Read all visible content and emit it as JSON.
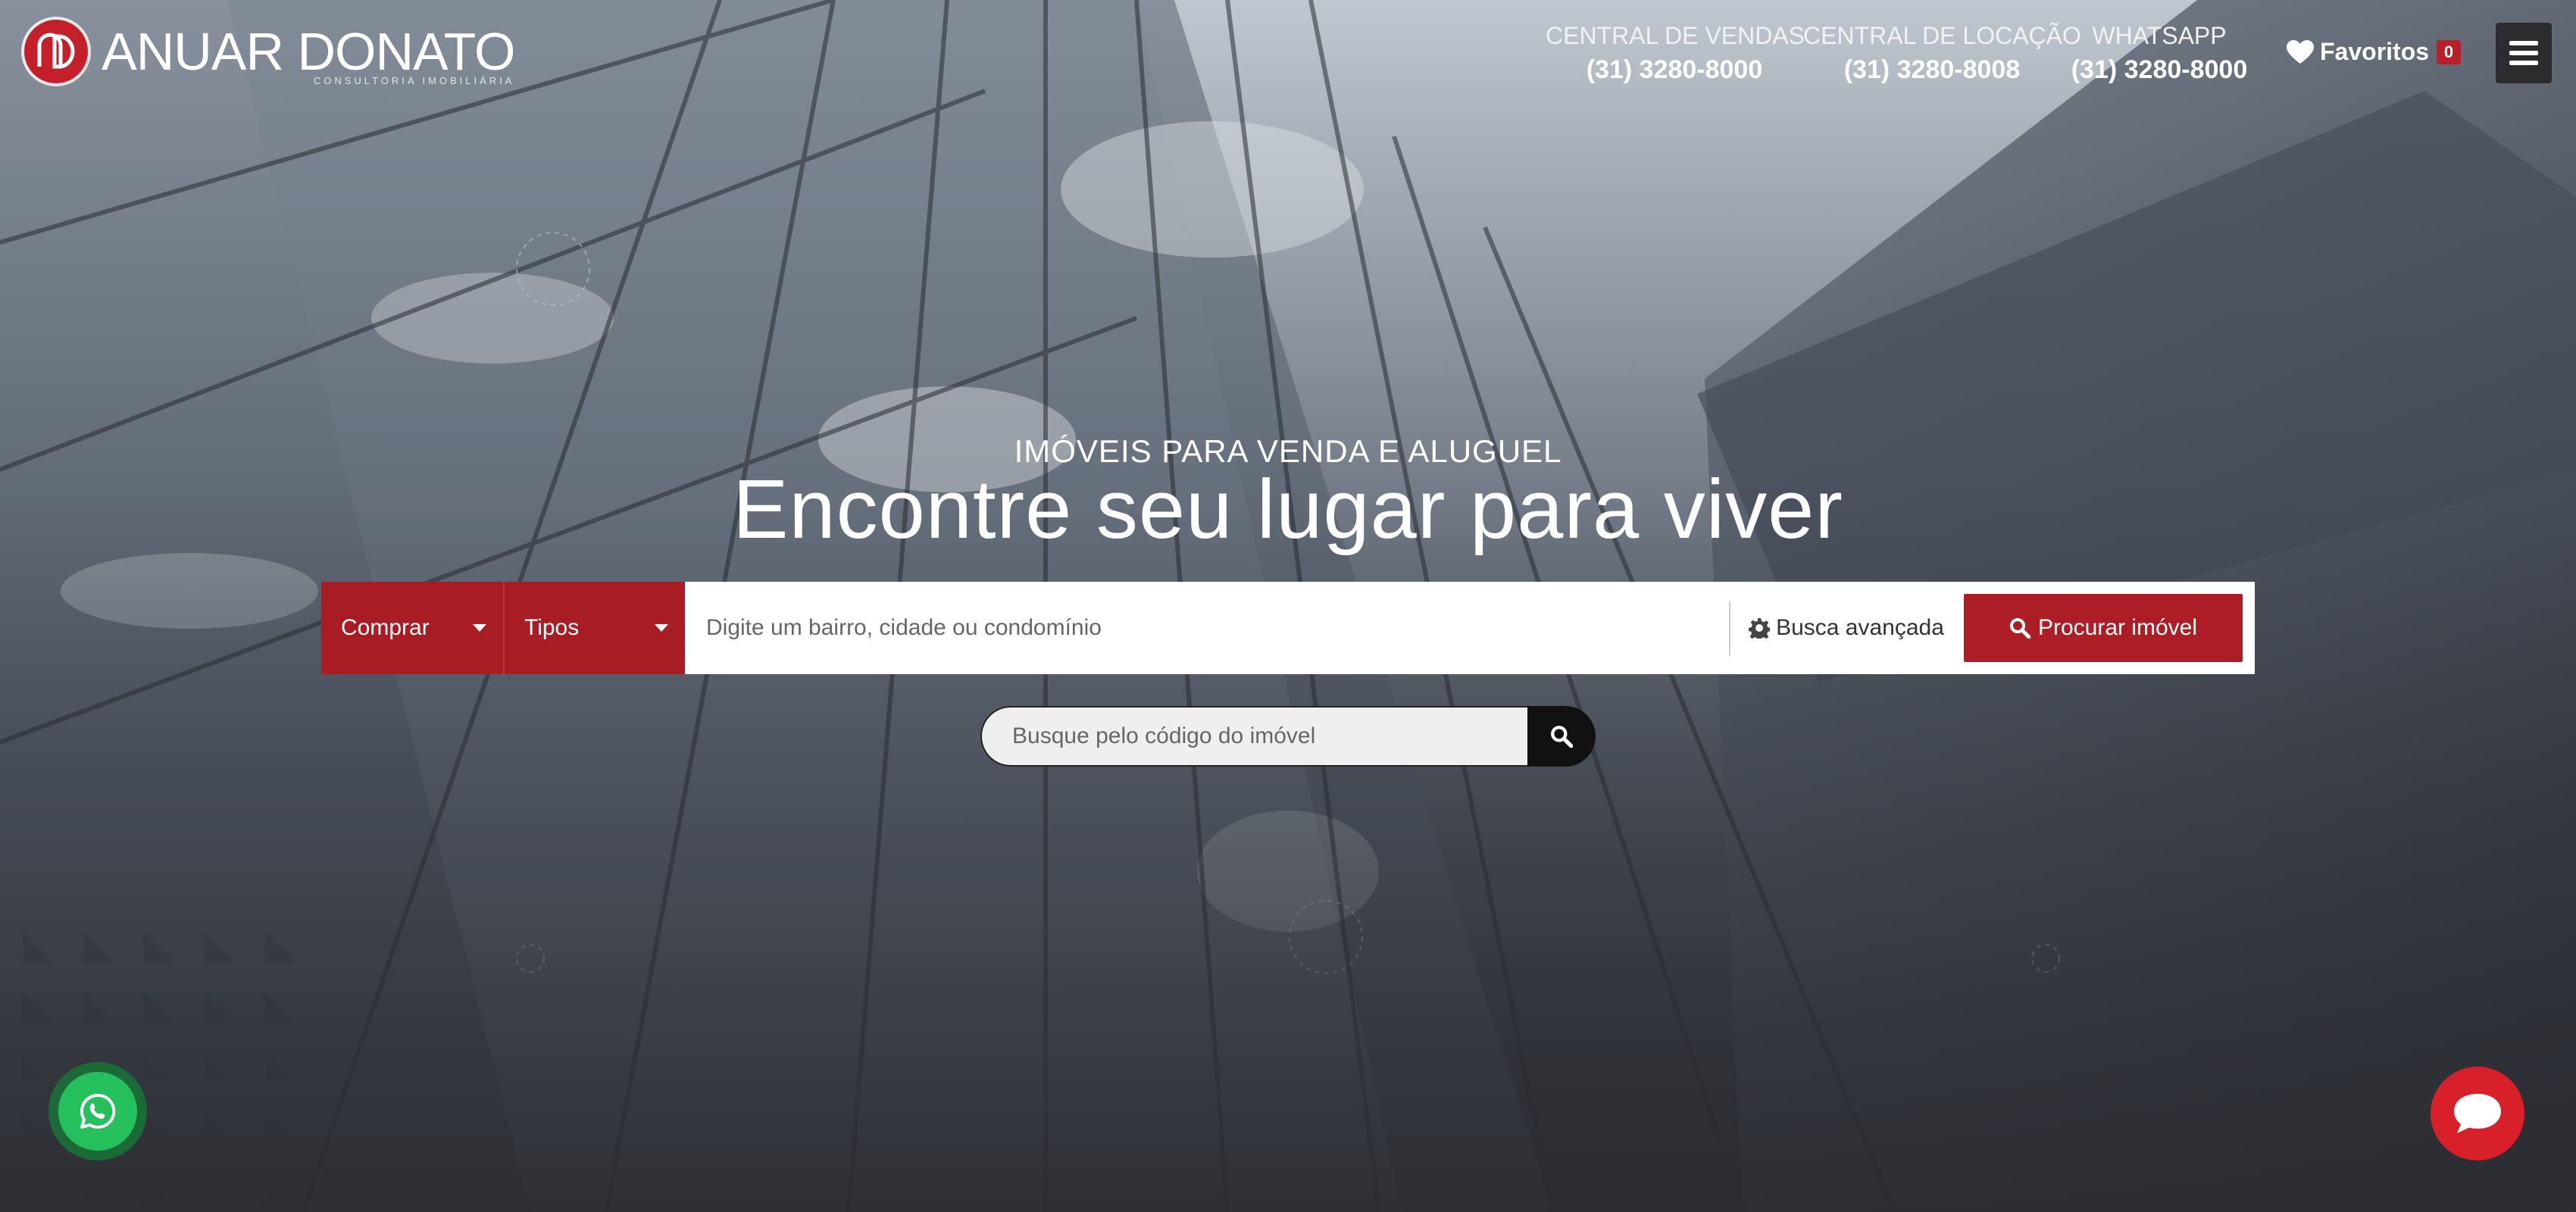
{
  "brand": {
    "name": "ANUAR DONATO",
    "subtitle": "CONSULTORIA IMOBILIÁRIA",
    "logo_icon": "ad-monogram-logo",
    "color": "#c4202a"
  },
  "contacts": [
    {
      "label": "CENTRAL DE VENDAS",
      "phone": "(31) 3280-8000"
    },
    {
      "label": "CENTRAL DE LOCAÇÃO",
      "phone": "(31) 3280-8008"
    },
    {
      "label": "WHATSAPP",
      "phone": "(31) 3280-8000"
    }
  ],
  "favorites": {
    "label": "Favoritos",
    "count": "0",
    "icon": "heart-icon"
  },
  "menu": {
    "icon": "hamburger-icon"
  },
  "hero": {
    "eyebrow": "IMÓVEIS PARA VENDA E ALUGUEL",
    "title": "Encontre seu lugar para viver"
  },
  "search": {
    "mode": "Comprar",
    "type": "Tipos",
    "placeholder": "Digite um bairro, cidade ou condomínio",
    "advanced_label": "Busca avançada",
    "submit_label": "Procurar imóvel",
    "accent": "#ac1d25"
  },
  "code_search": {
    "placeholder": "Busque pelo código do imóvel",
    "icon": "search-icon"
  },
  "floating": {
    "whatsapp_icon": "whatsapp-icon",
    "chat_icon": "chat-bubble-icon"
  }
}
